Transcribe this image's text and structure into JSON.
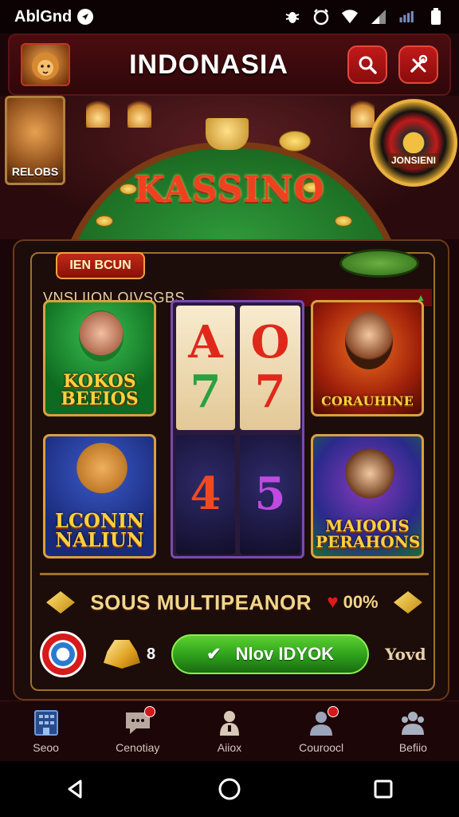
{
  "status_bar": {
    "carrier": "AblGnd"
  },
  "app_bar": {
    "title": "INDONASIA"
  },
  "scene": {
    "poster_label": "RELOBS",
    "table_title": "KASSINO",
    "roulette_label": "JONSIENI"
  },
  "panel": {
    "badge": "IEN BCUN",
    "section_title": "VNSLIION OIVSGBS",
    "games": [
      {
        "title": "KOKOS BEEIOS"
      },
      {
        "title": "CORAUHINE"
      },
      {
        "title": "LCONIN NALIUN"
      },
      {
        "title": "MAIOOIS PERAHONS"
      }
    ],
    "reels": {
      "top_left": "A",
      "top_left_bottom": "7",
      "top_right": "O",
      "top_right_bottom": "7",
      "bottom_left": "4",
      "bottom_right": "5"
    },
    "multiplier": "SOUS MULTIPEANOR",
    "percent": "00%",
    "count": "8",
    "play_label": "Nlov IDYOK",
    "side_text": "Yovd"
  },
  "nav": [
    {
      "label": "Seoo",
      "color": "#3a6ab0"
    },
    {
      "label": "Cenotiay",
      "color": "#b8a8a0"
    },
    {
      "label": "Aiiox",
      "color": "#d8c8b8"
    },
    {
      "label": "Couroocl",
      "color": "#9aa4ba"
    },
    {
      "label": "Befiio",
      "color": "#a8b0c0"
    }
  ]
}
